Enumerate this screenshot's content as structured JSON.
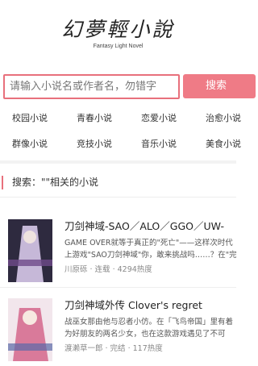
{
  "header": {
    "logo_text": "幻夢輕小說",
    "logo_subtitle": "Fantasy Light Novel"
  },
  "search": {
    "placeholder": "请输入小说名或作者名，勿错字",
    "button_label": "搜索"
  },
  "categories": [
    "校园小说",
    "青春小说",
    "恋爱小说",
    "治愈小说",
    "群像小说",
    "竞技小说",
    "音乐小说",
    "美食小说"
  ],
  "results": {
    "heading": "搜索：\"\"相关的小说",
    "books": [
      {
        "title": "刀剑神域-SAO／ALO／GGO／UW-",
        "desc_line1": "GAME OVER就等于真正的\"死亡\"——这样次时代",
        "desc_line2": "上游戏\"SAO刀剑神域\"你，敢来挑战吗……？在\"完",
        "meta": "川原砾 · 连载 · 4294热度",
        "cover_colors": [
          "#2e2a3f",
          "#c6b8d8",
          "#6e4a8a"
        ]
      },
      {
        "title": "刀剑神域外传 Clover's regret",
        "desc_line1": "战巫女那由他与忍者小仿。在「飞鸟帝国」里有着",
        "desc_line2": "为好朋友的两名少女，也在这款游戏遇见了不可",
        "meta": "渡濑草一郎 · 完结 · 117热度",
        "cover_colors": [
          "#f2e6ec",
          "#d97a9a",
          "#5a6aa8"
        ]
      }
    ]
  }
}
